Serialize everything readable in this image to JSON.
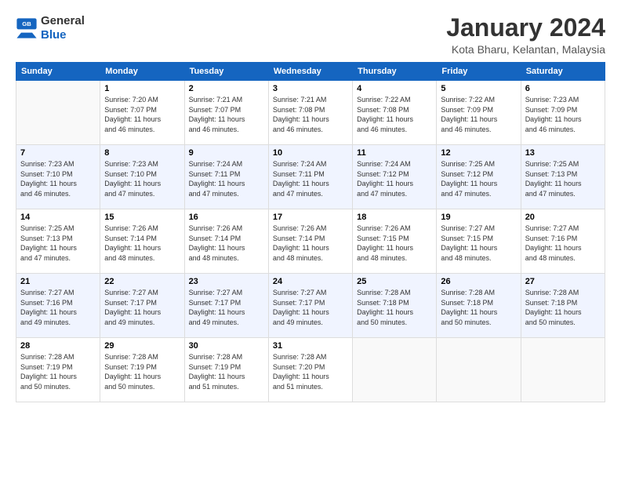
{
  "header": {
    "logo": {
      "general": "General",
      "blue": "Blue"
    },
    "title": "January 2024",
    "location": "Kota Bharu, Kelantan, Malaysia"
  },
  "days_of_week": [
    "Sunday",
    "Monday",
    "Tuesday",
    "Wednesday",
    "Thursday",
    "Friday",
    "Saturday"
  ],
  "weeks": [
    [
      {
        "day": "",
        "info": ""
      },
      {
        "day": "1",
        "info": "Sunrise: 7:20 AM\nSunset: 7:07 PM\nDaylight: 11 hours\nand 46 minutes."
      },
      {
        "day": "2",
        "info": "Sunrise: 7:21 AM\nSunset: 7:07 PM\nDaylight: 11 hours\nand 46 minutes."
      },
      {
        "day": "3",
        "info": "Sunrise: 7:21 AM\nSunset: 7:08 PM\nDaylight: 11 hours\nand 46 minutes."
      },
      {
        "day": "4",
        "info": "Sunrise: 7:22 AM\nSunset: 7:08 PM\nDaylight: 11 hours\nand 46 minutes."
      },
      {
        "day": "5",
        "info": "Sunrise: 7:22 AM\nSunset: 7:09 PM\nDaylight: 11 hours\nand 46 minutes."
      },
      {
        "day": "6",
        "info": "Sunrise: 7:23 AM\nSunset: 7:09 PM\nDaylight: 11 hours\nand 46 minutes."
      }
    ],
    [
      {
        "day": "7",
        "info": "Sunrise: 7:23 AM\nSunset: 7:10 PM\nDaylight: 11 hours\nand 46 minutes."
      },
      {
        "day": "8",
        "info": "Sunrise: 7:23 AM\nSunset: 7:10 PM\nDaylight: 11 hours\nand 47 minutes."
      },
      {
        "day": "9",
        "info": "Sunrise: 7:24 AM\nSunset: 7:11 PM\nDaylight: 11 hours\nand 47 minutes."
      },
      {
        "day": "10",
        "info": "Sunrise: 7:24 AM\nSunset: 7:11 PM\nDaylight: 11 hours\nand 47 minutes."
      },
      {
        "day": "11",
        "info": "Sunrise: 7:24 AM\nSunset: 7:12 PM\nDaylight: 11 hours\nand 47 minutes."
      },
      {
        "day": "12",
        "info": "Sunrise: 7:25 AM\nSunset: 7:12 PM\nDaylight: 11 hours\nand 47 minutes."
      },
      {
        "day": "13",
        "info": "Sunrise: 7:25 AM\nSunset: 7:13 PM\nDaylight: 11 hours\nand 47 minutes."
      }
    ],
    [
      {
        "day": "14",
        "info": "Sunrise: 7:25 AM\nSunset: 7:13 PM\nDaylight: 11 hours\nand 47 minutes."
      },
      {
        "day": "15",
        "info": "Sunrise: 7:26 AM\nSunset: 7:14 PM\nDaylight: 11 hours\nand 48 minutes."
      },
      {
        "day": "16",
        "info": "Sunrise: 7:26 AM\nSunset: 7:14 PM\nDaylight: 11 hours\nand 48 minutes."
      },
      {
        "day": "17",
        "info": "Sunrise: 7:26 AM\nSunset: 7:14 PM\nDaylight: 11 hours\nand 48 minutes."
      },
      {
        "day": "18",
        "info": "Sunrise: 7:26 AM\nSunset: 7:15 PM\nDaylight: 11 hours\nand 48 minutes."
      },
      {
        "day": "19",
        "info": "Sunrise: 7:27 AM\nSunset: 7:15 PM\nDaylight: 11 hours\nand 48 minutes."
      },
      {
        "day": "20",
        "info": "Sunrise: 7:27 AM\nSunset: 7:16 PM\nDaylight: 11 hours\nand 48 minutes."
      }
    ],
    [
      {
        "day": "21",
        "info": "Sunrise: 7:27 AM\nSunset: 7:16 PM\nDaylight: 11 hours\nand 49 minutes."
      },
      {
        "day": "22",
        "info": "Sunrise: 7:27 AM\nSunset: 7:17 PM\nDaylight: 11 hours\nand 49 minutes."
      },
      {
        "day": "23",
        "info": "Sunrise: 7:27 AM\nSunset: 7:17 PM\nDaylight: 11 hours\nand 49 minutes."
      },
      {
        "day": "24",
        "info": "Sunrise: 7:27 AM\nSunset: 7:17 PM\nDaylight: 11 hours\nand 49 minutes."
      },
      {
        "day": "25",
        "info": "Sunrise: 7:28 AM\nSunset: 7:18 PM\nDaylight: 11 hours\nand 50 minutes."
      },
      {
        "day": "26",
        "info": "Sunrise: 7:28 AM\nSunset: 7:18 PM\nDaylight: 11 hours\nand 50 minutes."
      },
      {
        "day": "27",
        "info": "Sunrise: 7:28 AM\nSunset: 7:18 PM\nDaylight: 11 hours\nand 50 minutes."
      }
    ],
    [
      {
        "day": "28",
        "info": "Sunrise: 7:28 AM\nSunset: 7:19 PM\nDaylight: 11 hours\nand 50 minutes."
      },
      {
        "day": "29",
        "info": "Sunrise: 7:28 AM\nSunset: 7:19 PM\nDaylight: 11 hours\nand 50 minutes."
      },
      {
        "day": "30",
        "info": "Sunrise: 7:28 AM\nSunset: 7:19 PM\nDaylight: 11 hours\nand 51 minutes."
      },
      {
        "day": "31",
        "info": "Sunrise: 7:28 AM\nSunset: 7:20 PM\nDaylight: 11 hours\nand 51 minutes."
      },
      {
        "day": "",
        "info": ""
      },
      {
        "day": "",
        "info": ""
      },
      {
        "day": "",
        "info": ""
      }
    ]
  ]
}
